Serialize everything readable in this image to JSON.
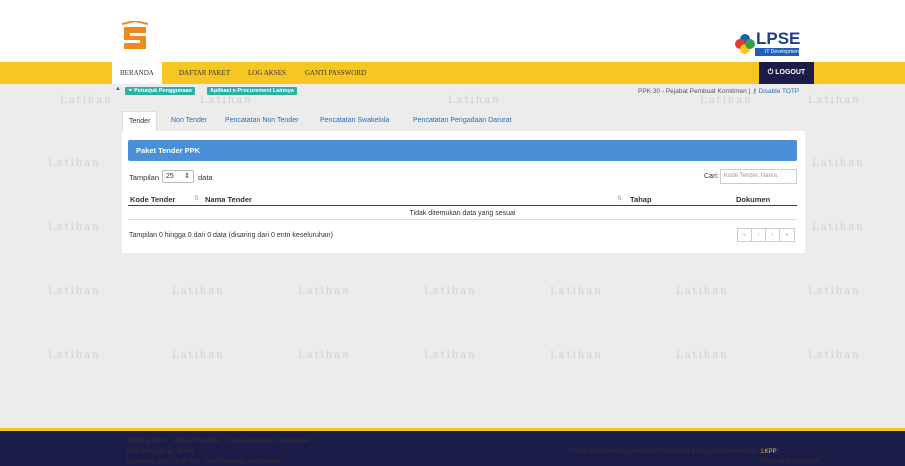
{
  "watermark_text": "Latihan",
  "header": {
    "logo_right_text": "LPSE",
    "logo_right_sub": "IT Development"
  },
  "nav": {
    "items": [
      "BERANDA",
      "DAFTAR PAKET",
      "LOG AKSES",
      "GANTI PASSWORD"
    ],
    "logout": "LOGOUT"
  },
  "subbar": {
    "badge1": "Petunjuk Penggunaan",
    "badge2": "Aplikasi e-Procurement Lainnya",
    "user": "PPK 30 - Pejabat Pembuat Komitmen |",
    "totp": "Disable TOTP"
  },
  "tabs": [
    "Tender",
    "Non Tender",
    "Pencatatan Non Tender",
    "Pencatatan Swakelola",
    "Pencatatan Pengadaan Darurat"
  ],
  "panel": {
    "title": "Paket Tender PPK",
    "length_label": "Tampilan",
    "length_value": "25",
    "length_suffix": "data",
    "search_label": "Cari:",
    "search_placeholder": "Kode Tender, Nama",
    "columns": [
      "Kode Tender",
      "Nama Tender",
      "Tahap",
      "Dokumen"
    ],
    "empty_text": "Tidak ditemukan data yang sesuai",
    "info": "Tampilan 0 hingga 0 dari 0 data (disaring dari 0 entri keseluruhan)",
    "pager": [
      "«",
      "‹",
      "›",
      "»"
    ]
  },
  "footer": {
    "links": [
      "Tentang Kami",
      "Pakta Integritas",
      "Persyaratan dan Ketentuan"
    ],
    "visitors": "Total Pengunjung: 28.646",
    "date": "12 Agustus 2020 13:30 WIB - Sesi Pelatihan: Sesi Default",
    "copyright": "© 2006-2020 Lembaga Kebijakan Pengadaan Barang/Jasa Pemerintah (",
    "lkpp": "LKPP",
    "copyright_end": ")",
    "version": "SPSE v4.3u20200809"
  },
  "colors": {
    "nav_bg": "#f6c623",
    "footer_bg": "#1c1c48",
    "panel_head": "#4a90d8",
    "badge": "#2eb1a5"
  }
}
